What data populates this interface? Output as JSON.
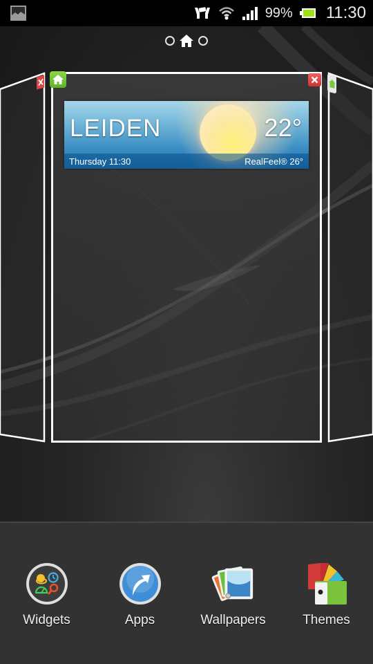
{
  "status_bar": {
    "left_icon": "gallery-notification-icon",
    "icons": [
      "hands-sync-icon",
      "wifi-icon",
      "signal-icon"
    ],
    "battery_percent": "99%",
    "battery_icon": "battery-icon",
    "time": "11:30"
  },
  "page_indicator": {
    "pages": [
      "page",
      "home",
      "page"
    ],
    "active": "home"
  },
  "homescreen_editor": {
    "main_pane": {
      "home_badge": "home-icon",
      "close_badge": "close-icon"
    },
    "left_pane": {
      "close_badge": "close-icon"
    },
    "right_pane": {
      "home_badge": "home-icon"
    }
  },
  "weather_widget": {
    "city": "LEIDEN",
    "temperature": "22°",
    "day_time": "Thursday 11:30",
    "realfeel": "RealFeel® 26°",
    "condition_icon": "sun-icon"
  },
  "dock": {
    "items": [
      {
        "label": "Widgets",
        "icon": "widgets-icon"
      },
      {
        "label": "Apps",
        "icon": "apps-icon"
      },
      {
        "label": "Wallpapers",
        "icon": "wallpapers-icon"
      },
      {
        "label": "Themes",
        "icon": "themes-icon"
      }
    ]
  }
}
